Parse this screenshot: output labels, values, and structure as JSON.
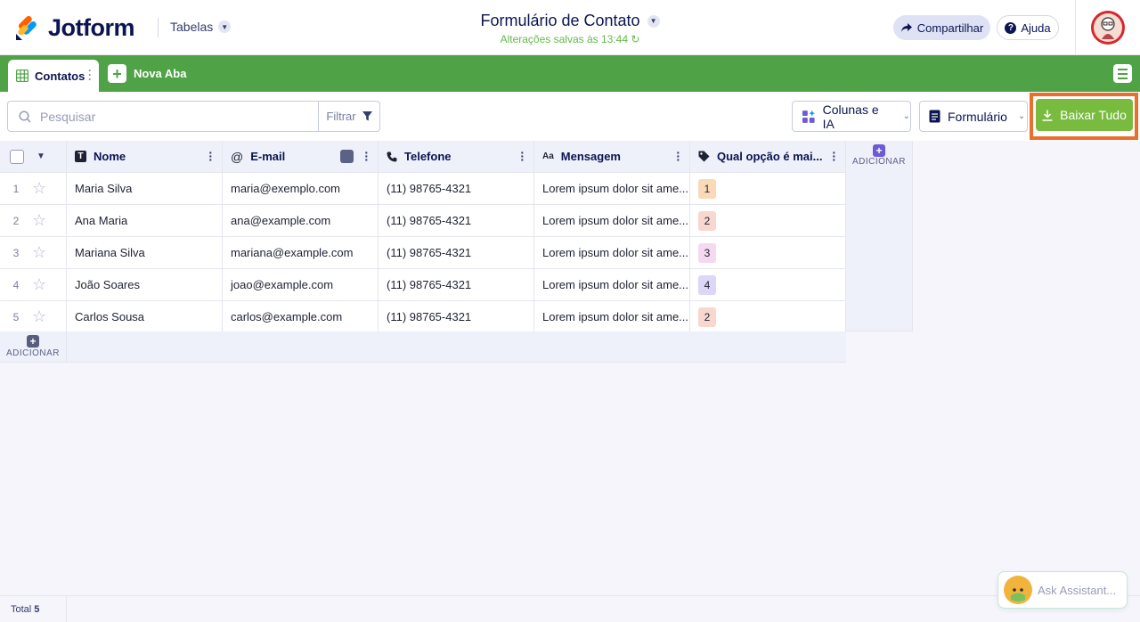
{
  "header": {
    "brand": "Jotform",
    "section_label": "Tabelas",
    "form_title": "Formulário de Contato",
    "saved_status": "Alterações salvas às 13:44",
    "share_label": "Compartilhar",
    "help_label": "Ajuda"
  },
  "tabs": {
    "active_label": "Contatos",
    "new_tab_label": "Nova Aba"
  },
  "toolbar": {
    "search_placeholder": "Pesquisar",
    "filter_label": "Filtrar",
    "columns_label": "Colunas e IA",
    "form_label": "Formulário",
    "download_label": "Baixar Tudo"
  },
  "table": {
    "columns": {
      "name": "Nome",
      "email": "E-mail",
      "phone": "Telefone",
      "message": "Mensagem",
      "option": "Qual opção é mai..."
    },
    "add_column_label": "ADICIONAR",
    "add_row_label": "ADICIONAR",
    "rows": [
      {
        "index": "1",
        "name": "Maria Silva",
        "email": "maria@exemplo.com",
        "phone": "(11) 98765-4321",
        "message": "Lorem ipsum dolor sit ame...",
        "option": "1",
        "option_color": "#f9d9b8"
      },
      {
        "index": "2",
        "name": "Ana Maria",
        "email": "ana@example.com",
        "phone": "(11) 98765-4321",
        "message": "Lorem ipsum dolor sit ame...",
        "option": "2",
        "option_color": "#f8d7cf"
      },
      {
        "index": "3",
        "name": "Mariana Silva",
        "email": "mariana@example.com",
        "phone": "(11) 98765-4321",
        "message": "Lorem ipsum dolor sit ame...",
        "option": "3",
        "option_color": "#f5d9f1"
      },
      {
        "index": "4",
        "name": "João Soares",
        "email": "joao@example.com",
        "phone": "(11) 98765-4321",
        "message": "Lorem ipsum dolor sit ame...",
        "option": "4",
        "option_color": "#ddd6f7"
      },
      {
        "index": "5",
        "name": "Carlos Sousa",
        "email": "carlos@example.com",
        "phone": "(11) 98765-4321",
        "message": "Lorem ipsum dolor sit ame...",
        "option": "2",
        "option_color": "#f8d7cf"
      }
    ]
  },
  "footer": {
    "total_label": "Total",
    "total_count": "5"
  },
  "assistant": {
    "placeholder": "Ask Assistant..."
  },
  "colors": {
    "brand_green": "#4fa246",
    "download_green": "#78bb3f",
    "highlight_orange": "#e96f2b",
    "navy": "#0a1551"
  },
  "icons": [
    "jotform-logo-icon",
    "chevron-down-icon",
    "share-arrow-icon",
    "help-icon",
    "avatar",
    "table-grid-icon",
    "plus-icon",
    "menu-icon",
    "search-icon",
    "filter-icon",
    "sparkle-columns-icon",
    "form-icon",
    "download-icon",
    "text-type-icon",
    "at-icon",
    "phone-icon",
    "long-text-icon",
    "tag-icon",
    "star-icon",
    "assistant-cat-icon"
  ]
}
